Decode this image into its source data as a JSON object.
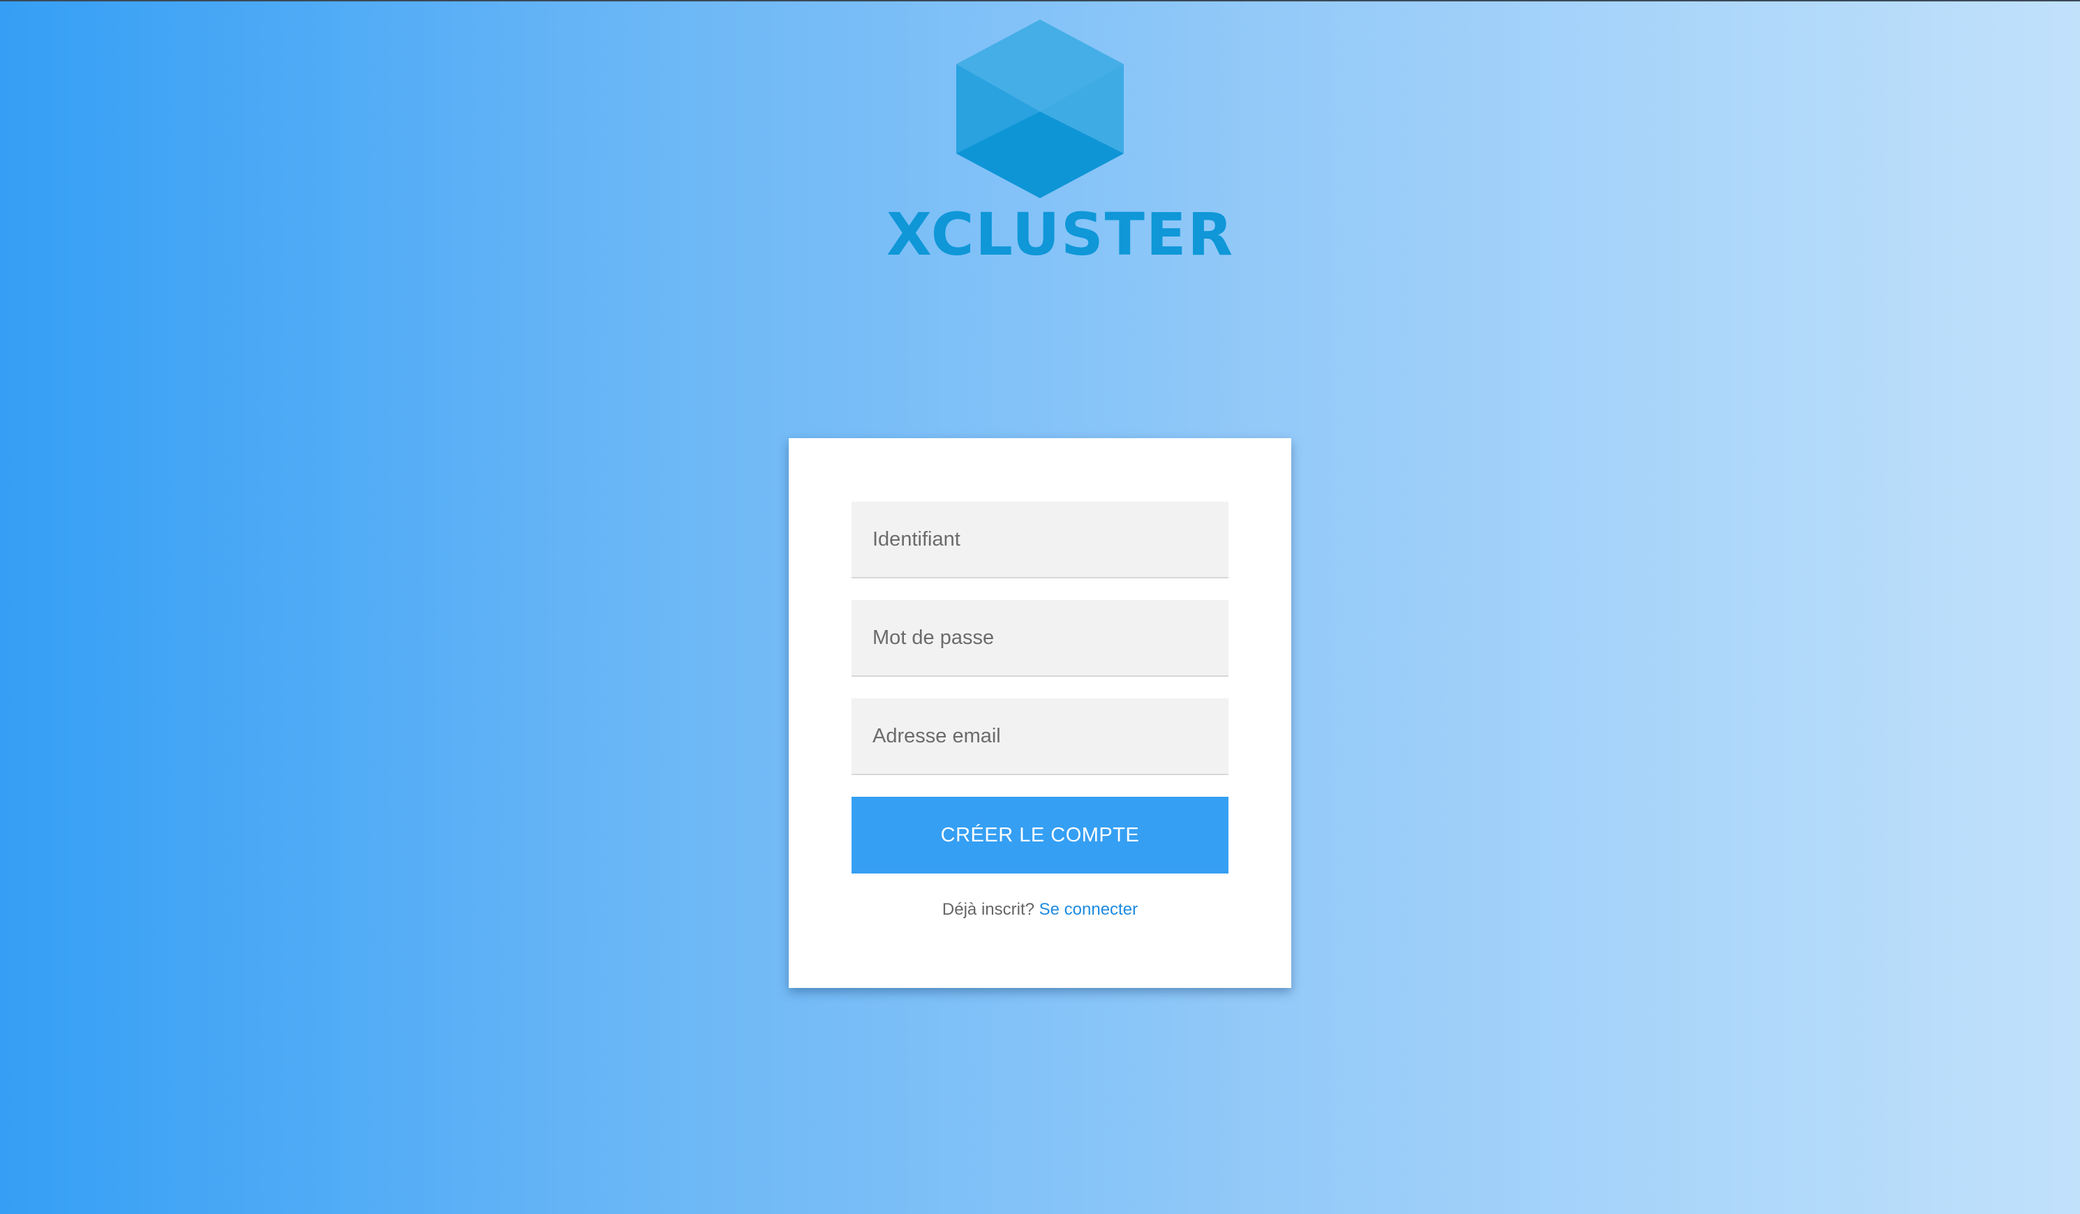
{
  "logo": {
    "text": "XCLUSTER",
    "colors": {
      "hex_top": "#45aee6",
      "hex_left": "#2aa2e0",
      "hex_bottom": "#0e95d6",
      "text": "#0f97d8"
    }
  },
  "form": {
    "username_placeholder": "Identifiant",
    "password_placeholder": "Mot de passe",
    "email_placeholder": "Adresse email",
    "submit_label": "CRÉER LE COMPTE",
    "footer_text": "Déjà inscrit?",
    "login_link": "Se connecter"
  },
  "colors": {
    "accent": "#359ff3",
    "link": "#1e8be0",
    "background_start": "#359ff5",
    "background_end": "#c1e1fb"
  }
}
